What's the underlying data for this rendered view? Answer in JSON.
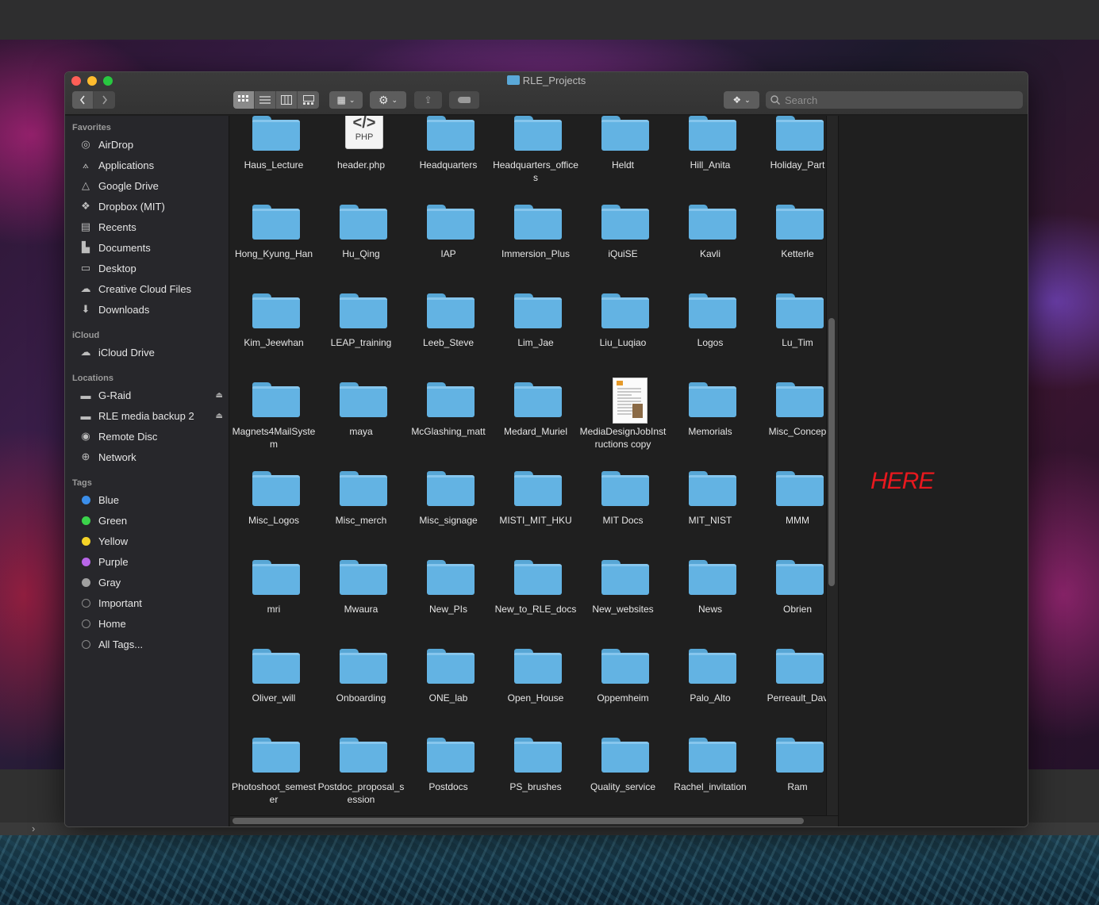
{
  "window": {
    "title": "RLE_Projects"
  },
  "toolbar": {
    "search_placeholder": "Search"
  },
  "sidebar": {
    "favorites_heading": "Favorites",
    "favorites": [
      {
        "label": "AirDrop",
        "icon": "airdrop-icon"
      },
      {
        "label": "Applications",
        "icon": "applications-icon"
      },
      {
        "label": "Google Drive",
        "icon": "google-drive-icon"
      },
      {
        "label": "Dropbox (MIT)",
        "icon": "dropbox-icon"
      },
      {
        "label": "Recents",
        "icon": "recents-icon"
      },
      {
        "label": "Documents",
        "icon": "documents-icon"
      },
      {
        "label": "Desktop",
        "icon": "desktop-icon"
      },
      {
        "label": "Creative Cloud Files",
        "icon": "creative-cloud-icon"
      },
      {
        "label": "Downloads",
        "icon": "downloads-icon"
      }
    ],
    "icloud_heading": "iCloud",
    "icloud": [
      {
        "label": "iCloud Drive",
        "icon": "cloud-icon"
      }
    ],
    "locations_heading": "Locations",
    "locations": [
      {
        "label": "G-Raid",
        "icon": "drive-icon"
      },
      {
        "label": "RLE media backup 2",
        "icon": "drive-icon"
      },
      {
        "label": "Remote Disc",
        "icon": "disc-icon"
      },
      {
        "label": "Network",
        "icon": "network-icon"
      }
    ],
    "tags_heading": "Tags",
    "tags": [
      {
        "label": "Blue",
        "color": "#3b8eea"
      },
      {
        "label": "Green",
        "color": "#3bd34b"
      },
      {
        "label": "Yellow",
        "color": "#f5d327"
      },
      {
        "label": "Purple",
        "color": "#b866e8"
      },
      {
        "label": "Gray",
        "color": "#a0a0a0"
      },
      {
        "label": "Important",
        "color": ""
      },
      {
        "label": "Home",
        "color": ""
      },
      {
        "label": "All Tags...",
        "color": ""
      }
    ]
  },
  "files": [
    {
      "name": "Haus_Lecture",
      "kind": "folder"
    },
    {
      "name": "header.php",
      "kind": "php"
    },
    {
      "name": "Headquarters",
      "kind": "folder"
    },
    {
      "name": "Headquarters_offices",
      "kind": "folder"
    },
    {
      "name": "Heldt",
      "kind": "folder"
    },
    {
      "name": "Hill_Anita",
      "kind": "folder"
    },
    {
      "name": "Holiday_Part",
      "kind": "folder"
    },
    {
      "name": "Hong_Kyung_Han",
      "kind": "folder"
    },
    {
      "name": "Hu_Qing",
      "kind": "folder"
    },
    {
      "name": "IAP",
      "kind": "folder"
    },
    {
      "name": "Immersion_Plus",
      "kind": "folder"
    },
    {
      "name": "iQuiSE",
      "kind": "folder"
    },
    {
      "name": "Kavli",
      "kind": "folder"
    },
    {
      "name": "Ketterle",
      "kind": "folder"
    },
    {
      "name": "Kim_Jeewhan",
      "kind": "folder"
    },
    {
      "name": "LEAP_training",
      "kind": "folder"
    },
    {
      "name": "Leeb_Steve",
      "kind": "folder"
    },
    {
      "name": "Lim_Jae",
      "kind": "folder"
    },
    {
      "name": "Liu_Luqiao",
      "kind": "folder"
    },
    {
      "name": "Logos",
      "kind": "folder"
    },
    {
      "name": "Lu_Tim",
      "kind": "folder"
    },
    {
      "name": "Magnets4MailSystem",
      "kind": "folder"
    },
    {
      "name": "maya",
      "kind": "folder"
    },
    {
      "name": "McGlashing_matt",
      "kind": "folder"
    },
    {
      "name": "Medard_Muriel",
      "kind": "folder"
    },
    {
      "name": "MediaDesignJobInstructions copy",
      "kind": "doc"
    },
    {
      "name": "Memorials",
      "kind": "folder"
    },
    {
      "name": "Misc_Concep",
      "kind": "folder"
    },
    {
      "name": "Misc_Logos",
      "kind": "folder"
    },
    {
      "name": "Misc_merch",
      "kind": "folder"
    },
    {
      "name": "Misc_signage",
      "kind": "folder"
    },
    {
      "name": "MISTI_MIT_HKU",
      "kind": "folder"
    },
    {
      "name": "MIT Docs",
      "kind": "folder"
    },
    {
      "name": "MIT_NIST",
      "kind": "folder"
    },
    {
      "name": "MMM",
      "kind": "folder"
    },
    {
      "name": "mri",
      "kind": "folder"
    },
    {
      "name": "Mwaura",
      "kind": "folder"
    },
    {
      "name": "New_PIs",
      "kind": "folder"
    },
    {
      "name": "New_to_RLE_docs",
      "kind": "folder"
    },
    {
      "name": "New_websites",
      "kind": "folder"
    },
    {
      "name": "News",
      "kind": "folder"
    },
    {
      "name": "Obrien",
      "kind": "folder"
    },
    {
      "name": "Oliver_will",
      "kind": "folder"
    },
    {
      "name": "Onboarding",
      "kind": "folder"
    },
    {
      "name": "ONE_lab",
      "kind": "folder"
    },
    {
      "name": "Open_House",
      "kind": "folder"
    },
    {
      "name": "Oppemheim",
      "kind": "folder"
    },
    {
      "name": "Palo_Alto",
      "kind": "folder"
    },
    {
      "name": "Perreault_Dav",
      "kind": "folder"
    },
    {
      "name": "Photoshoot_semester",
      "kind": "folder"
    },
    {
      "name": "Postdoc_proposal_session",
      "kind": "folder"
    },
    {
      "name": "Postdocs",
      "kind": "folder"
    },
    {
      "name": "PS_brushes",
      "kind": "folder"
    },
    {
      "name": "Quality_service",
      "kind": "folder"
    },
    {
      "name": "Rachel_invitation",
      "kind": "folder"
    },
    {
      "name": "Ram",
      "kind": "folder"
    }
  ],
  "php_icon": {
    "code": "</>",
    "ext": "PHP"
  },
  "preview": {
    "annotation": "HERE",
    "annotation_color": "#e8181e"
  },
  "desktop": {
    "strip_glyph": "›"
  }
}
